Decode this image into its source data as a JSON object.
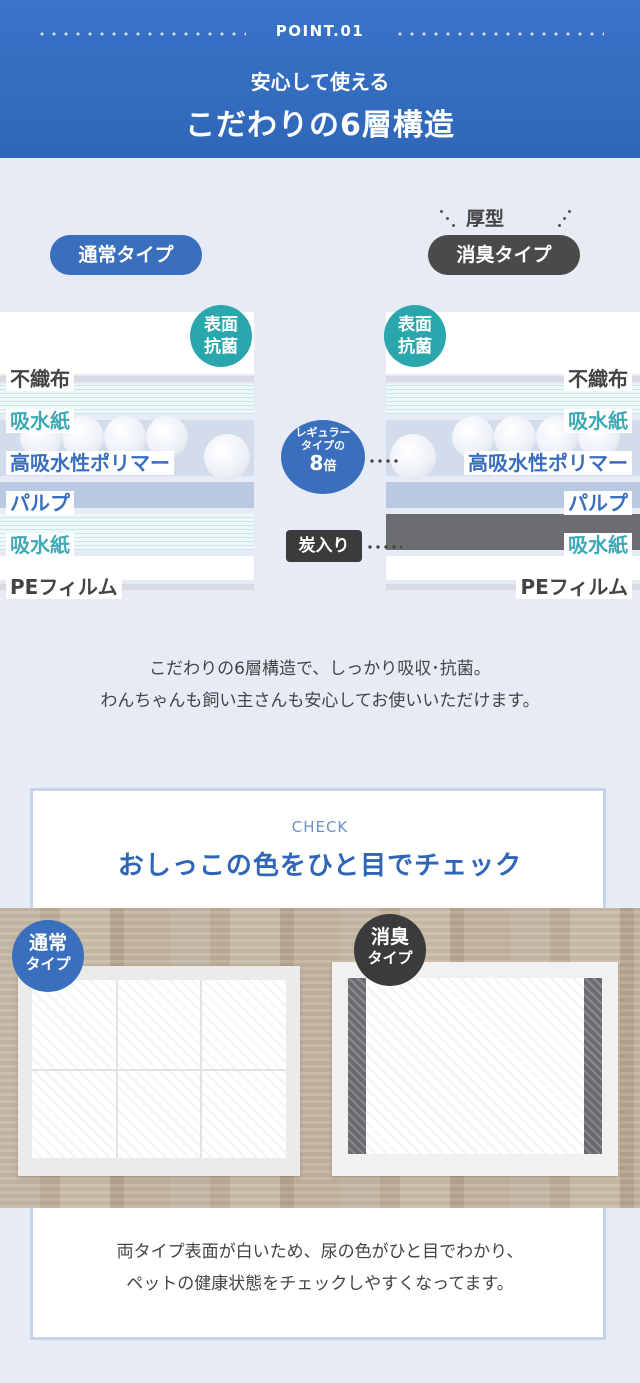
{
  "header": {
    "point_label": "POINT.01",
    "sub_title": "安心して使える",
    "main_title": "こだわりの6層構造"
  },
  "types": {
    "normal": "通常タイプ",
    "thick_label": "厚型",
    "deodorant": "消臭タイプ"
  },
  "layers": {
    "surface_badge_line1": "表面",
    "surface_badge_line2": "抗菌",
    "nonwoven": "不織布",
    "absorbent_paper": "吸水紙",
    "polymer": "高吸水性ポリマー",
    "pulp": "パルプ",
    "pe_film": "PEフィルム"
  },
  "regular_badge": {
    "line1": "レギュラー",
    "line2": "タイプの",
    "multiplier": "8",
    "unit": "倍"
  },
  "carbon_label": "炭入り",
  "description": {
    "line1": "こだわりの6層構造で、しっかり吸収･抗菌。",
    "line2": "わんちゃんも飼い主さんも安心してお使いいただけます。"
  },
  "check": {
    "label": "CHECK",
    "title": "おしっこの色をひと目でチェック"
  },
  "photo_badges": {
    "normal_line1": "通常",
    "normal_line2": "タイプ",
    "deodorant_line1": "消臭",
    "deodorant_line2": "タイプ"
  },
  "bottom_text": {
    "line1": "両タイプ表面が白いため、尿の色がひと目でわかり、",
    "line2": "ペットの健康状態をチェックしやすくなってます。"
  },
  "colors": {
    "brand_blue": "#3a6fbe",
    "teal": "#2aa7ad",
    "dark": "#3b3b3b",
    "background": "#e6ebf5"
  }
}
